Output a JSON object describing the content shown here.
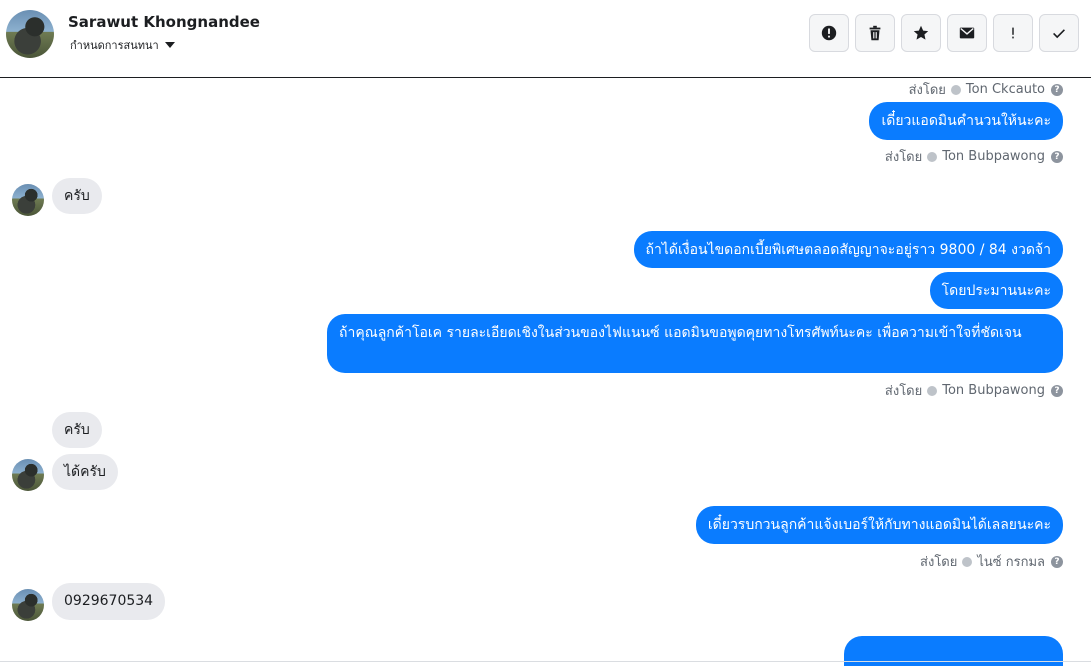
{
  "header": {
    "name": "Sarawut Khongnandee",
    "subtitle": "กำหนดการสนทนา",
    "tools": [
      "alert-icon",
      "trash-icon",
      "star-icon",
      "mail-icon",
      "exclamation-icon",
      "check-icon"
    ]
  },
  "sent_by_label": "ส่งโดย",
  "messages": {
    "m0_meta": "Ton Ckcauto",
    "m1": "เดี๋ยวแอดมินคำนวนให้นะคะ",
    "m1_meta": "Ton Bubpawong",
    "m2": "ครับ",
    "m3": "ถ้าได้เงื่อนไขดอกเบี้ยพิเศษตลอดสัญญาจะอยู่ราว 9800 / 84 งวดจ้า",
    "m4": "โดยประมานนะคะ",
    "m5": "ถ้าคุณลูกค้าโอเค รายละเอียดเชิงในส่วนของไฟแนนซ์ แอดมินขอพูดคุยทางโทรศัพท์นะคะ เพื่อความเข้าใจที่ชัดเจน",
    "m5_meta": "Ton Bubpawong",
    "m6": "ครับ",
    "m7": "ได้ครับ",
    "m8": "เดี๋ยวรบกวนลูกค้าแจ้งเบอร์ให้กับทางแอดมินได้เลลยนะคะ",
    "m8_meta": "ไนซ์ กรกมล",
    "m9": "0929670534"
  },
  "colors": {
    "outgoing": "#0a7cff",
    "incoming": "#e9eaee"
  }
}
